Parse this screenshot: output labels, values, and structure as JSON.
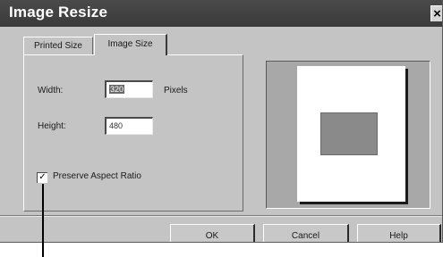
{
  "window": {
    "title": "Image Resize",
    "close_glyph": "×"
  },
  "tabs": [
    {
      "label": "Printed Size",
      "active": false
    },
    {
      "label": "Image Size",
      "active": true
    }
  ],
  "image_size": {
    "width_label": "Width:",
    "width_value": "320",
    "width_unit": "Pixels",
    "height_label": "Height:",
    "height_value": "480",
    "preserve_aspect_label": "Preserve Aspect Ratio",
    "preserve_aspect_checked": true,
    "check_glyph": "✓"
  },
  "buttons": {
    "ok": "OK",
    "cancel": "Cancel",
    "help": "Help"
  },
  "colors": {
    "dialog_bg": "#c4c4c4",
    "titlebar_bg": "#3a3a3a",
    "preview_bg": "#a8a8a8"
  },
  "icons": {
    "close": "close-icon",
    "check": "checkmark-icon"
  }
}
